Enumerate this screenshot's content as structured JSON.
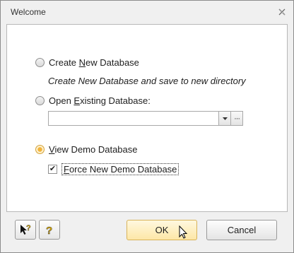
{
  "window": {
    "title": "Welcome",
    "close_icon": "close-icon"
  },
  "options": {
    "create_new": {
      "label_pre": "Create ",
      "label_accel": "N",
      "label_post": "ew Database",
      "selected": false,
      "description": "Create New Database and save to new directory"
    },
    "open_existing": {
      "label_pre": "Open ",
      "label_accel": "E",
      "label_post": "xisting Database:",
      "selected": false,
      "path_value": "",
      "dropdown_icon": "chevron-down-icon",
      "browse_label": "···"
    },
    "view_demo": {
      "label_pre": "",
      "label_accel": "V",
      "label_post": "iew Demo Database",
      "selected": true
    },
    "force_new_demo": {
      "label_pre": "",
      "label_accel": "F",
      "label_post": "orce New Demo Database",
      "checked": true,
      "check_glyph": "✔"
    }
  },
  "footer": {
    "help_pointer_icon": "help-pointer-icon",
    "help_icon": "help-icon",
    "ok_label": "OK",
    "cancel_label": "Cancel"
  },
  "colors": {
    "accent_selected": "#f1b33b",
    "ok_button_top": "#fff8df",
    "ok_button_bottom": "#fde7a7"
  }
}
